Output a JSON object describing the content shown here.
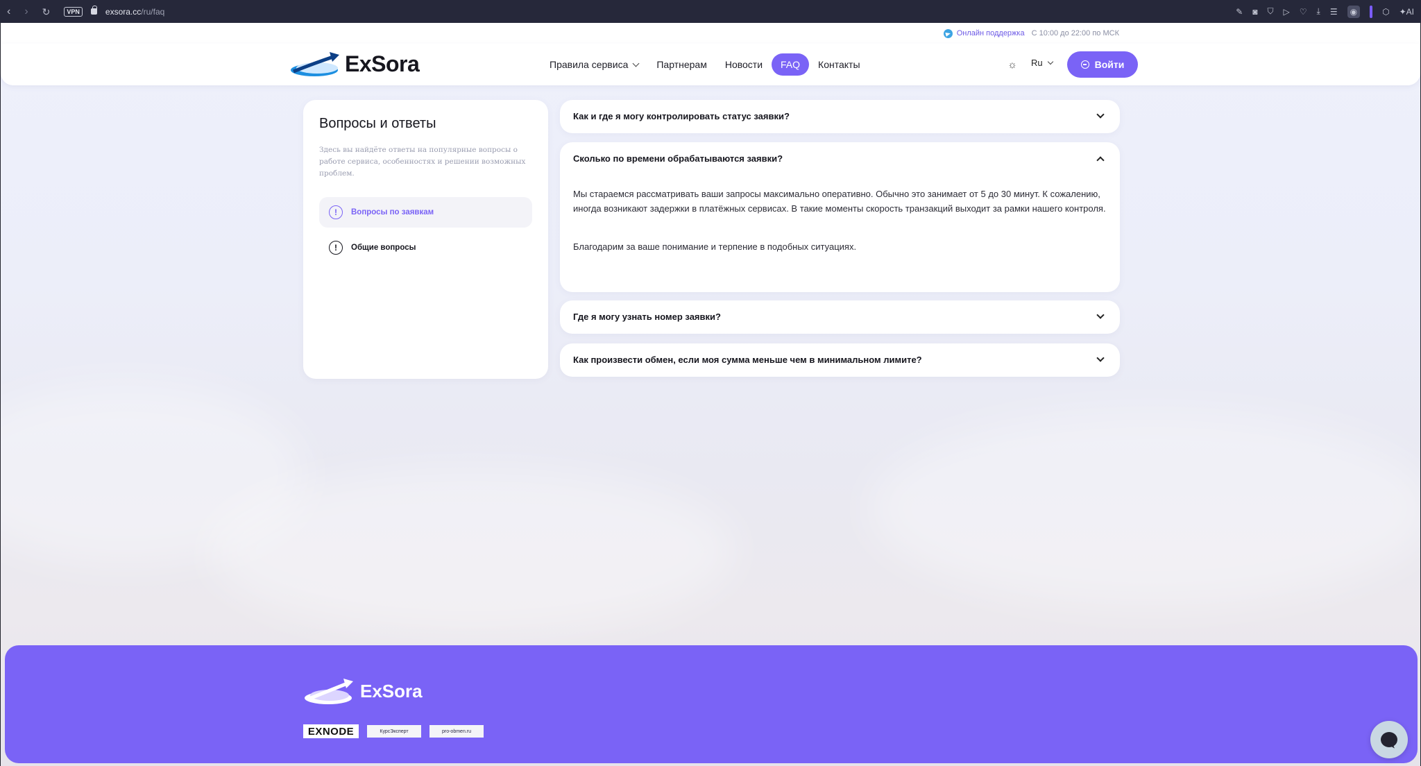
{
  "browser": {
    "vpn_label": "VPN",
    "url_host": "exsora.cc",
    "url_path": "/ru/faq",
    "ai_label": "AI"
  },
  "topbar": {
    "support_link": "Онлайн поддержка",
    "support_hours": "С 10:00 до 22:00 по МСК"
  },
  "header": {
    "brand": "ExSora",
    "nav": [
      {
        "label": "Правила сервиса",
        "has_dropdown": true
      },
      {
        "label": "Партнерам"
      },
      {
        "label": "Новости"
      },
      {
        "label": "FAQ",
        "active": true
      },
      {
        "label": "Контакты"
      }
    ],
    "theme_icon": "sun-icon",
    "language": "Ru",
    "login_label": "Войти"
  },
  "sidebar": {
    "title": "Вопросы и ответы",
    "description": "Здесь вы найдёте ответы на популярные вопросы о работе сервиса, особенностях и решении возможных проблем.",
    "categories": [
      {
        "label": "Вопросы по заявкам",
        "active": true,
        "icon_glyph": "!"
      },
      {
        "label": "Общие вопросы",
        "active": false,
        "icon_glyph": "!"
      }
    ]
  },
  "faq": [
    {
      "question": "Как и где я могу контролировать статус заявки?",
      "expanded": false
    },
    {
      "question": "Сколько по времени обрабатываются заявки?",
      "expanded": true,
      "answer_p1": "Мы стараемся рассматривать ваши запросы максимально оперативно. Обычно это занимает от 5 до 30 минут. К сожалению, иногда возникают задержки в платёжных сервисах. В такие моменты скорость транзакций выходит за рамки нашего контроля.",
      "answer_p2": "Благодарим за ваше понимание и терпение в подобных ситуациях."
    },
    {
      "question": "Где я могу узнать номер заявки?",
      "expanded": false
    },
    {
      "question": "Как произвести обмен, если моя сумма меньше чем в минимальном лимите?",
      "expanded": false
    }
  ],
  "footer": {
    "brand": "ExSora",
    "partners": [
      "EXNODE",
      "КурсЭксперт",
      "pro-obmen.ru"
    ]
  },
  "colors": {
    "accent": "#7a63f6",
    "footer_bg": "#7a63f6",
    "telegram": "#3da4e3"
  }
}
